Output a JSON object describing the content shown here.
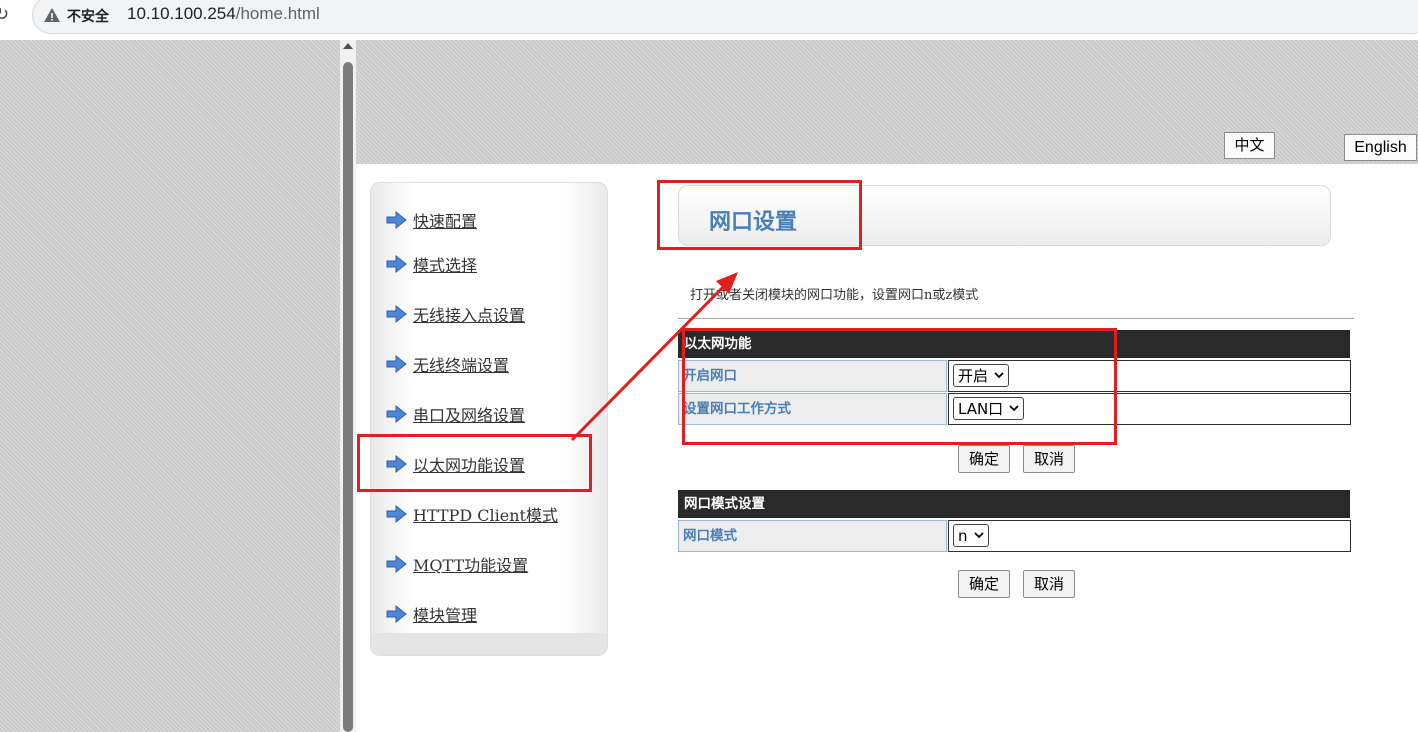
{
  "browser": {
    "security_label": "不安全",
    "url_host": "10.10.100.254",
    "url_path": "/home.html"
  },
  "language": {
    "chinese": "中文",
    "english": "English"
  },
  "sidebar": {
    "items": [
      {
        "label": "快速配置"
      },
      {
        "label": "模式选择"
      },
      {
        "label": "无线接入点设置"
      },
      {
        "label": "无线终端设置"
      },
      {
        "label": "串口及网络设置"
      },
      {
        "label": "以太网功能设置"
      },
      {
        "label": "HTTPD Client模式"
      },
      {
        "label": "MQTT功能设置"
      },
      {
        "label": "模块管理"
      }
    ]
  },
  "main": {
    "title": "网口设置",
    "description": "打开或者关闭模块的网口功能，设置网口n或z模式",
    "ethernet": {
      "header": "以太网功能",
      "enable_label": "开启网口",
      "enable_value": "开启",
      "workmode_label": "设置网口工作方式",
      "workmode_value": "LAN口",
      "ok": "确定",
      "cancel": "取消"
    },
    "port_mode": {
      "header": "网口模式设置",
      "mode_label": "网口模式",
      "mode_value": "n",
      "ok": "确定",
      "cancel": "取消"
    }
  },
  "colors": {
    "annotation": "#e02020",
    "header_bg": "#2a2a2a",
    "label_text": "#4d7fb4",
    "title_text": "#4a7fb5"
  }
}
